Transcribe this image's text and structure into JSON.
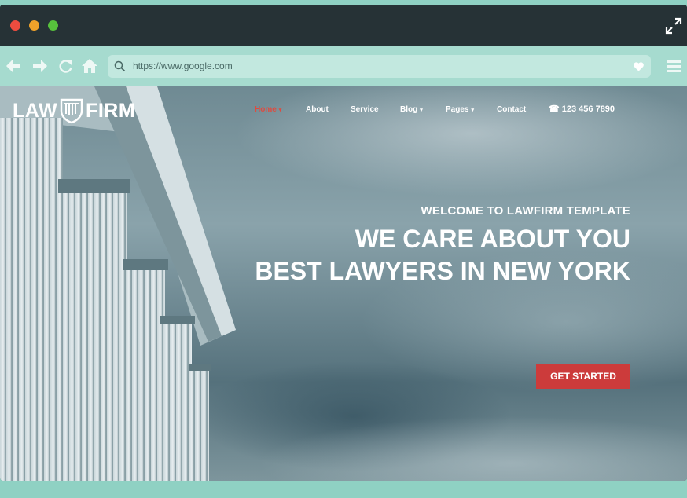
{
  "browser": {
    "url": "https://www.google.com"
  },
  "site": {
    "logo_left": "LAW",
    "logo_right": "FIRM",
    "nav": [
      {
        "label": "Home",
        "caret": "▾",
        "active": true
      },
      {
        "label": "About"
      },
      {
        "label": "Service"
      },
      {
        "label": "Blog",
        "caret": "▾"
      },
      {
        "label": "Pages",
        "caret": "▾"
      },
      {
        "label": "Contact"
      }
    ],
    "phone": "☎ 123 456 7890"
  },
  "hero": {
    "welcome": "WELCOME TO LAWFIRM TEMPLATE",
    "headline_1": "WE CARE ABOUT YOU",
    "headline_2": "BEST LAWYERS IN NEW YORK",
    "cta_label": "GET STARTED"
  },
  "colors": {
    "accent": "#e04a3e",
    "cta": "#cc3b3b",
    "frame": "#8fd1c3",
    "titlebar": "#263236"
  },
  "icons": [
    "close-dot",
    "minimize-dot",
    "maximize-dot",
    "expand-icon",
    "back-arrow-icon",
    "forward-arrow-icon",
    "reload-icon",
    "home-icon",
    "search-icon",
    "heart-icon",
    "hamburger-menu-icon",
    "shield-logo-icon",
    "phone-icon"
  ]
}
